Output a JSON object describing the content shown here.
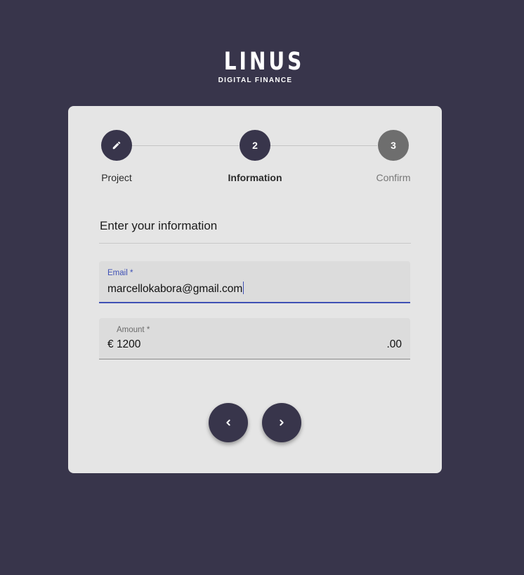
{
  "logo": {
    "main": "LINUS",
    "sub": "DIGITAL FINANCE"
  },
  "stepper": {
    "steps": [
      {
        "label": "Project",
        "icon": "pencil-icon",
        "state": "completed"
      },
      {
        "label": "Information",
        "number": "2",
        "state": "active"
      },
      {
        "label": "Confirm",
        "number": "3",
        "state": "inactive"
      }
    ]
  },
  "form": {
    "title": "Enter your information",
    "email": {
      "label": "Email *",
      "value": "marcellokabora@gmail.com"
    },
    "amount": {
      "label": "Amount *",
      "currency": "€",
      "value": "1200",
      "suffix": ".00"
    }
  },
  "nav": {
    "back_icon": "chevron-left-icon",
    "next_icon": "chevron-right-icon"
  },
  "colors": {
    "background": "#38354b",
    "card": "#e5e5e5",
    "accent": "#3f51b5",
    "step_active": "#38354b",
    "step_inactive": "#6e6e6e"
  }
}
